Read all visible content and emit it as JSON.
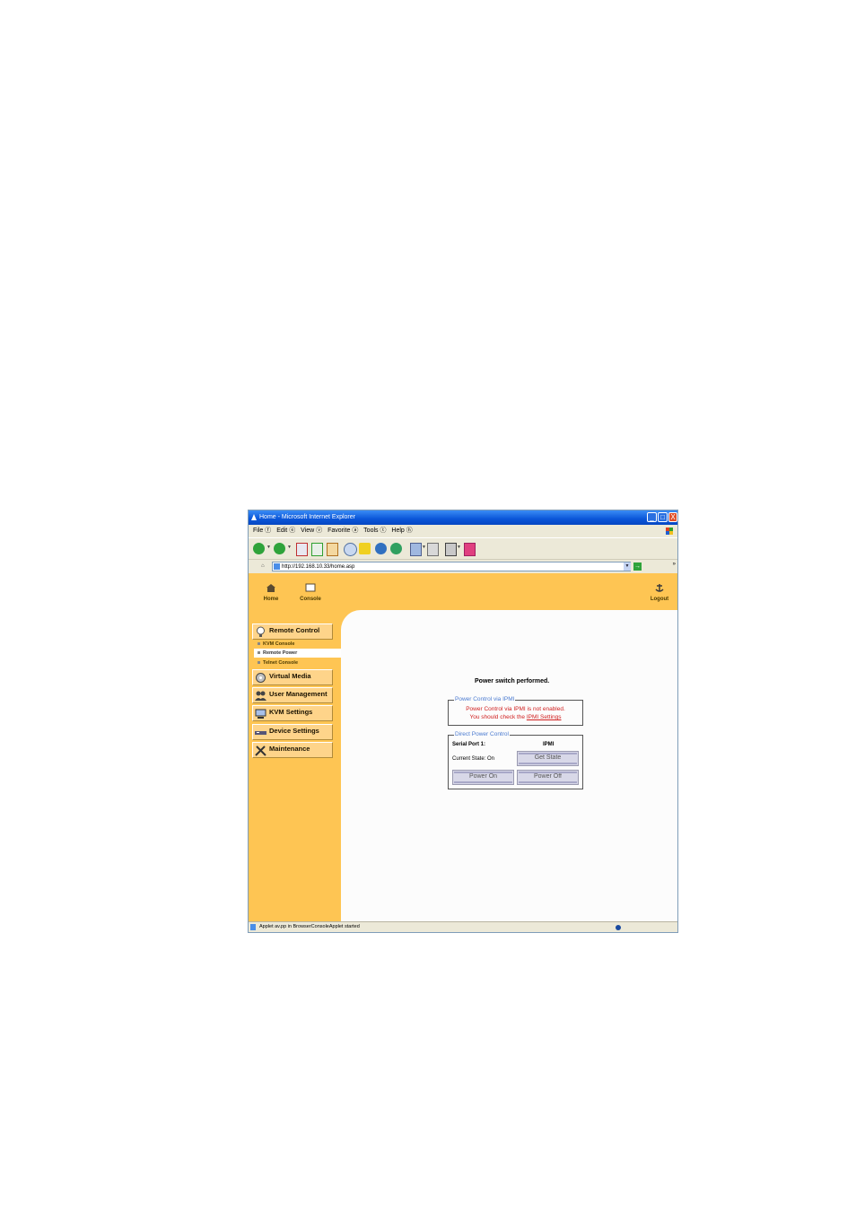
{
  "window": {
    "title": "Home - Microsoft Internet Explorer",
    "controls": {
      "minimize": "_",
      "maximize": "□",
      "close": "X"
    }
  },
  "menu": [
    "File ⓕ",
    "Edit ⓔ",
    "View ⓥ",
    "Favorite ⓐ",
    "Tools ⓣ",
    "Help ⓗ"
  ],
  "toolbar": {
    "icons": [
      "back-icon",
      "forward-icon",
      "stop-icon",
      "refresh-icon",
      "home-icon",
      "search-icon",
      "favorites-icon",
      "media-icon",
      "history-icon",
      "mail-icon",
      "print-icon",
      "edit-icon",
      "messenger-icon"
    ]
  },
  "address": {
    "url": "http://192.168.10.33/home.asp",
    "go": "→"
  },
  "topnav": {
    "home": "Home",
    "console": "Console",
    "logout": "Logout"
  },
  "sidebar": {
    "remote_control": "Remote Control",
    "kvm_console": "KVM Console",
    "remote_power": "Remote Power",
    "telnet_console": "Telnet Console",
    "virtual_media": "Virtual Media",
    "user_management": "User Management",
    "kvm_settings": "KVM Settings",
    "device_settings": "Device Settings",
    "maintenance": "Maintenance"
  },
  "main": {
    "message": "Power switch performed.",
    "ipmi_group": {
      "legend": "Power Control via IPMI",
      "line1": "Power Control via IPMI is not enabled.",
      "line2_prefix": "You should check the ",
      "line2_link": "IPMI Settings"
    },
    "direct_group": {
      "legend": "Direct Power Control",
      "serial_port": "Serial Port 1:",
      "ipmi": "IPMI",
      "current_state": "Current State: On",
      "get_state": "Get State",
      "power_on": "Power On",
      "power_off": "Power Off"
    }
  },
  "status": {
    "text": "Applet av.pp in BrowserConsoleApplet started"
  },
  "colors": {
    "accent": "#fec553",
    "titlebar": "#0a55d8",
    "legend": "#4a7ad0",
    "warning": "#d02020"
  }
}
